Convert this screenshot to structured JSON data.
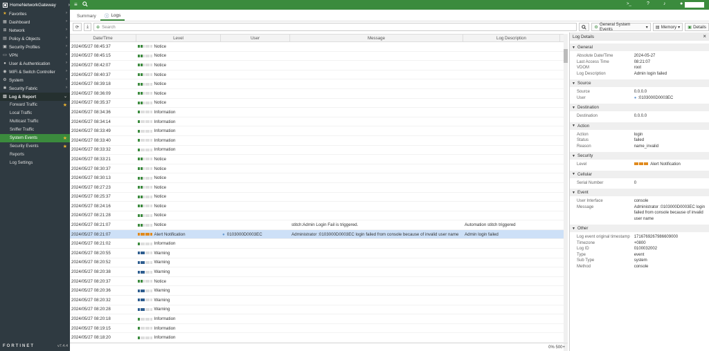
{
  "topbar": {
    "hostname": "HomeNetworkGateway",
    "search_icon": "search-icon",
    "menu_icon": "hamburger-icon",
    "cli_label": ">_",
    "help_label": "?",
    "bell_label": "1",
    "user_label": "admin"
  },
  "sidebar": {
    "items": [
      {
        "label": "Favorites",
        "icon": "star-icon"
      },
      {
        "label": "Dashboard",
        "icon": "dashboard-icon"
      },
      {
        "label": "Network",
        "icon": "network-icon"
      },
      {
        "label": "Policy & Objects",
        "icon": "policy-icon"
      },
      {
        "label": "Security Profiles",
        "icon": "lock-icon"
      },
      {
        "label": "VPN",
        "icon": "vpn-icon"
      },
      {
        "label": "User & Authentication",
        "icon": "user-icon"
      },
      {
        "label": "WiFi & Switch Controller",
        "icon": "wifi-icon"
      },
      {
        "label": "System",
        "icon": "gear-icon"
      },
      {
        "label": "Security Fabric",
        "icon": "fabric-icon"
      },
      {
        "label": "Log & Report",
        "icon": "log-icon"
      }
    ],
    "subitems": [
      {
        "label": "Forward Traffic",
        "star": true
      },
      {
        "label": "Local Traffic",
        "star": false
      },
      {
        "label": "Multicast Traffic",
        "star": false
      },
      {
        "label": "Sniffer Traffic",
        "star": false
      },
      {
        "label": "System Events",
        "star": true
      },
      {
        "label": "Security Events",
        "star": true
      },
      {
        "label": "Reports",
        "star": false
      },
      {
        "label": "Log Settings",
        "star": false
      }
    ],
    "brand": "FORTINET",
    "version": "v7.4.4"
  },
  "tabs": [
    {
      "label": "Summary"
    },
    {
      "label": "Logs"
    }
  ],
  "toolbar": {
    "search_placeholder": "Search",
    "filter_label": "General System Events",
    "memory_label": "Memory",
    "details_label": "Details"
  },
  "grid": {
    "headers": [
      "Date/Time",
      "Level",
      "User",
      "Message",
      "Log Description"
    ],
    "rows": [
      {
        "dt": "2024/05/27 08:45:37",
        "level": "Notice",
        "user": "",
        "msg": "",
        "desc": ""
      },
      {
        "dt": "2024/05/27 08:45:15",
        "level": "Notice",
        "user": "",
        "msg": "",
        "desc": ""
      },
      {
        "dt": "2024/05/27 08:42:07",
        "level": "Notice",
        "user": "",
        "msg": "",
        "desc": ""
      },
      {
        "dt": "2024/05/27 08:40:37",
        "level": "Notice",
        "user": "",
        "msg": "",
        "desc": ""
      },
      {
        "dt": "2024/05/27 08:39:18",
        "level": "Notice",
        "user": "",
        "msg": "",
        "desc": ""
      },
      {
        "dt": "2024/05/27 08:36:09",
        "level": "Notice",
        "user": "",
        "msg": "",
        "desc": ""
      },
      {
        "dt": "2024/05/27 08:35:37",
        "level": "Notice",
        "user": "",
        "msg": "",
        "desc": ""
      },
      {
        "dt": "2024/05/27 08:34:36",
        "level": "Information",
        "user": "",
        "msg": "",
        "desc": ""
      },
      {
        "dt": "2024/05/27 08:34:14",
        "level": "Information",
        "user": "",
        "msg": "",
        "desc": ""
      },
      {
        "dt": "2024/05/27 08:33:49",
        "level": "Information",
        "user": "",
        "msg": "",
        "desc": ""
      },
      {
        "dt": "2024/05/27 08:33:40",
        "level": "Information",
        "user": "",
        "msg": "",
        "desc": ""
      },
      {
        "dt": "2024/05/27 08:33:32",
        "level": "Information",
        "user": "",
        "msg": "",
        "desc": ""
      },
      {
        "dt": "2024/05/27 08:33:21",
        "level": "Notice",
        "user": "",
        "msg": "",
        "desc": ""
      },
      {
        "dt": "2024/05/27 08:30:37",
        "level": "Notice",
        "user": "",
        "msg": "",
        "desc": ""
      },
      {
        "dt": "2024/05/27 08:30:13",
        "level": "Notice",
        "user": "",
        "msg": "",
        "desc": ""
      },
      {
        "dt": "2024/05/27 08:27:23",
        "level": "Notice",
        "user": "",
        "msg": "",
        "desc": ""
      },
      {
        "dt": "2024/05/27 08:25:37",
        "level": "Notice",
        "user": "",
        "msg": "",
        "desc": ""
      },
      {
        "dt": "2024/05/27 08:24:16",
        "level": "Notice",
        "user": "",
        "msg": "",
        "desc": ""
      },
      {
        "dt": "2024/05/27 08:21:28",
        "level": "Notice",
        "user": "",
        "msg": "",
        "desc": ""
      },
      {
        "dt": "2024/05/27 08:21:07",
        "level": "Notice",
        "user": "",
        "msg": "stitch:Admin Login Fail is triggered.",
        "desc": "Automation stitch triggered"
      },
      {
        "dt": "2024/05/27 08:21:07",
        "level": "Alert Notification",
        "user": "0103000D0003EC",
        "msg": "Administrator :0103000D0003EC login failed from console because of invalid user name",
        "desc": "Admin login failed",
        "selected": true
      },
      {
        "dt": "2024/05/27 08:21:02",
        "level": "Information",
        "user": "",
        "msg": "",
        "desc": ""
      },
      {
        "dt": "2024/05/27 08:20:55",
        "level": "Warning",
        "user": "",
        "msg": "",
        "desc": ""
      },
      {
        "dt": "2024/05/27 08:20:52",
        "level": "Warning",
        "user": "",
        "msg": "",
        "desc": ""
      },
      {
        "dt": "2024/05/27 08:20:38",
        "level": "Warning",
        "user": "",
        "msg": "",
        "desc": ""
      },
      {
        "dt": "2024/05/27 08:20:37",
        "level": "Notice",
        "user": "",
        "msg": "",
        "desc": ""
      },
      {
        "dt": "2024/05/27 08:20:36",
        "level": "Warning",
        "user": "",
        "msg": "",
        "desc": ""
      },
      {
        "dt": "2024/05/27 08:20:32",
        "level": "Warning",
        "user": "",
        "msg": "",
        "desc": ""
      },
      {
        "dt": "2024/05/27 08:20:28",
        "level": "Warning",
        "user": "",
        "msg": "",
        "desc": ""
      },
      {
        "dt": "2024/05/27 08:20:18",
        "level": "Information",
        "user": "",
        "msg": "",
        "desc": ""
      },
      {
        "dt": "2024/05/27 08:19:15",
        "level": "Information",
        "user": "",
        "msg": "",
        "desc": ""
      },
      {
        "dt": "2024/05/27 08:18:20",
        "level": "Information",
        "user": "",
        "msg": "",
        "desc": ""
      }
    ],
    "status": "0% 500+"
  },
  "levels": {
    "Notice": {
      "filled": 2,
      "color": "#3b8b3d"
    },
    "Information": {
      "filled": 1,
      "color": "#3b8b3d"
    },
    "Warning": {
      "filled": 3,
      "color": "#2e5d8f"
    },
    "Alert Notification": {
      "filled": 6,
      "color": "#e08a1e"
    }
  },
  "details": {
    "title": "Log Details",
    "sections": [
      {
        "name": "General",
        "fields": [
          [
            "Absolute Date/Time",
            "2024-05-27"
          ],
          [
            "Last Access Time",
            "08:21:07"
          ],
          [
            "VDOM",
            "root"
          ],
          [
            "Log Description",
            "Admin login failed"
          ]
        ]
      },
      {
        "name": "Source",
        "fields": [
          [
            "Source",
            "0.0.0.0"
          ],
          [
            "User",
            ":0103000D0003EC"
          ]
        ]
      },
      {
        "name": "Destination",
        "fields": [
          [
            "Destination",
            "0.0.0.0"
          ]
        ]
      },
      {
        "name": "Action",
        "fields": [
          [
            "Action",
            "login"
          ],
          [
            "Status",
            "failed"
          ],
          [
            "Reason",
            "name_invalid"
          ]
        ]
      },
      {
        "name": "Security",
        "fields": [
          [
            "Level",
            "Alert Notification"
          ]
        ]
      },
      {
        "name": "Cellular",
        "fields": [
          [
            "Serial Number",
            "0"
          ]
        ]
      },
      {
        "name": "Event",
        "fields": [
          [
            "User Interface",
            "console"
          ],
          [
            "Message",
            "Administrator :0103000D0003EC login failed from console because of invalid user name"
          ]
        ]
      },
      {
        "name": "Other",
        "fields": [
          [
            "Log event original timestamp",
            "1716769267986609000"
          ],
          [
            "Timezone",
            "+0800"
          ],
          [
            "Log ID",
            "0100032002"
          ],
          [
            "Type",
            "event"
          ],
          [
            "Sub Type",
            "system"
          ],
          [
            "Method",
            "console"
          ]
        ]
      }
    ]
  }
}
